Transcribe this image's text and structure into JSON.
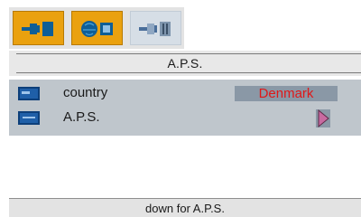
{
  "tabs": [
    {
      "icon": "picture-connector-icon",
      "active": false
    },
    {
      "icon": "globe-book-icon",
      "active": false
    },
    {
      "icon": "connector-icon",
      "active": true
    }
  ],
  "title": "A.P.S.",
  "menu": {
    "items": [
      {
        "label": "country",
        "value": "Denmark",
        "icon": "flag-screen-icon"
      },
      {
        "label": "A.P.S.",
        "icon": "tv-screen-icon",
        "arrow": "right-arrow-icon"
      }
    ]
  },
  "footer": {
    "hint": "down for A.P.S."
  },
  "colors": {
    "tab_orange": "#eaa10f",
    "menu_bg": "#bfc6cc",
    "value_text": "#e01818",
    "arrow_fill": "#c86aa0"
  }
}
